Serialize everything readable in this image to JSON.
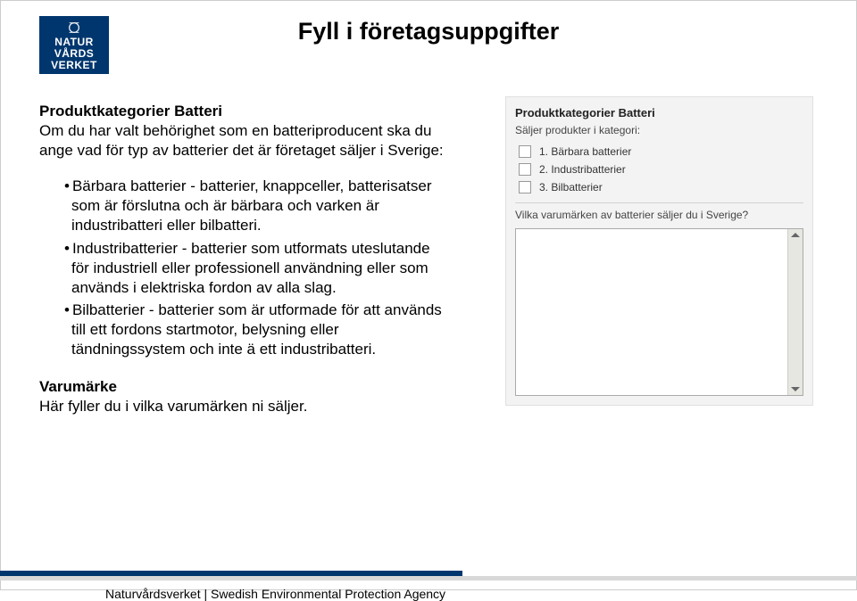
{
  "logo": {
    "line1": "NATUR",
    "line2": "VÅRDS",
    "line3": "VERKET"
  },
  "title": "Fyll i företagsuppgifter",
  "left": {
    "heading1": "Produktkategorier Batteri",
    "intro": "Om du har valt behörighet som en batteriproducent ska du ange vad för typ av batterier det är företaget säljer i Sverige:",
    "b1": "Bärbara batterier - batterier, knappceller, batterisatser som är förslutna och är bärbara och varken är industribatteri eller bilbatteri.",
    "b2": "Industribatterier - batterier som utformats uteslutande för industriell eller professionell användning eller som används i elektriska fordon av alla slag.",
    "b3": "Bilbatterier - batterier som är utformade för att används till ett fordons startmotor, belysning eller tändningssystem och inte ä ett industribatteri.",
    "heading2": "Varumärke",
    "varumarke_text": "Här fyller du i vilka varumärken ni säljer."
  },
  "panel": {
    "title": "Produktkategorier Batteri",
    "subtitle": "Säljer produkter i kategori:",
    "opt1": "1. Bärbara batterier",
    "opt2": "2. Industribatterier",
    "opt3": "3. Bilbatterier",
    "question": "Vilka varumärken av batterier säljer du i Sverige?",
    "textarea_value": ""
  },
  "footer": {
    "org_sv": "Naturvårdsverket",
    "sep": " | ",
    "org_en": "Swedish Environmental Protection Agency"
  }
}
